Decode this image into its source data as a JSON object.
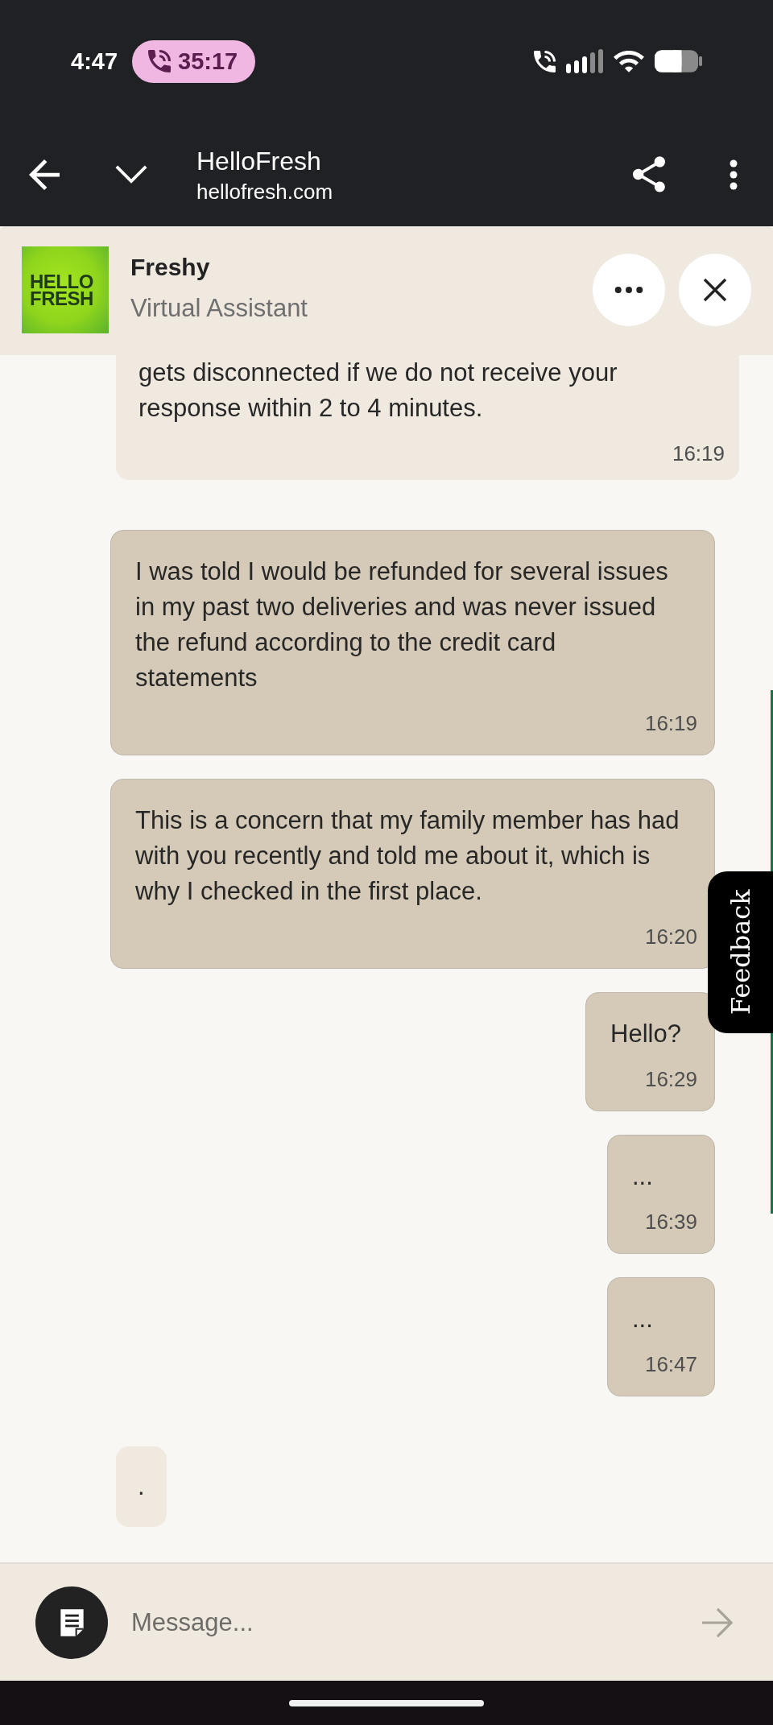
{
  "status_bar": {
    "time": "4:47",
    "call_timer": "35:17"
  },
  "browser_bar": {
    "title": "HelloFresh",
    "url": "hellofresh.com"
  },
  "chat_header": {
    "logo_text": "HELLO FRESH",
    "name": "Freshy",
    "subtitle": "Virtual Assistant"
  },
  "messages": [
    {
      "kind": "bot",
      "text": "gets disconnected if we do not receive your response within 2 to 4 minutes.",
      "time": "16:19"
    },
    {
      "kind": "user",
      "text": "I was told I would be refunded for several issues in my past two deliveries and was never issued the refund according to the credit card statements",
      "time": "16:19"
    },
    {
      "kind": "user",
      "text": "This is a concern that my family member has had with you recently and told me about it, which is why I checked in the first place.",
      "time": "16:20"
    },
    {
      "kind": "user",
      "text": "Hello?",
      "time": "16:29"
    },
    {
      "kind": "user",
      "text": "...",
      "time": "16:39"
    },
    {
      "kind": "user",
      "text": "...",
      "time": "16:47"
    },
    {
      "kind": "bot",
      "text": "."
    }
  ],
  "feedback_tab": {
    "label": "Feedback"
  },
  "composer": {
    "placeholder": "Message..."
  }
}
